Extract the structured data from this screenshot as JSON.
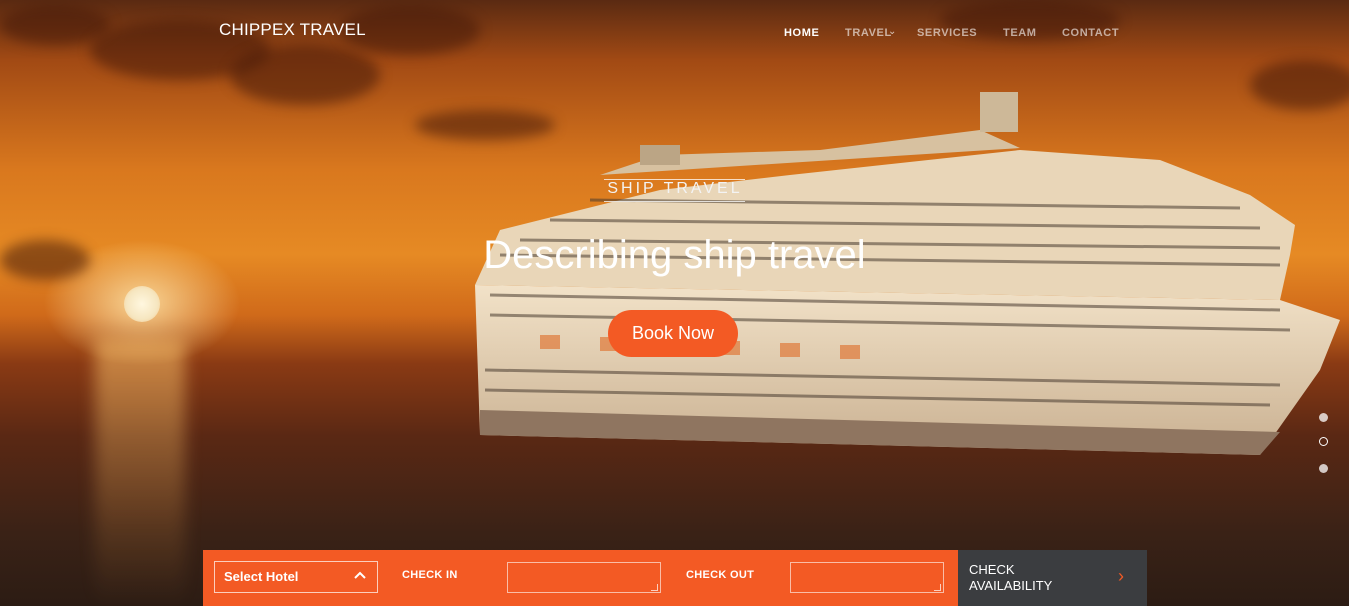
{
  "brand": {
    "name": "CHIPPEX TRAVEL"
  },
  "nav": {
    "items": [
      {
        "label": "HOME",
        "active": true
      },
      {
        "label": "TRAVEL",
        "active": false,
        "has_dropdown": true
      },
      {
        "label": "SERVICES",
        "active": false
      },
      {
        "label": "TEAM",
        "active": false
      },
      {
        "label": "CONTACT",
        "active": false
      }
    ]
  },
  "hero": {
    "kicker": "SHIP TRAVEL",
    "headline": "Describing ship travel",
    "cta_label": "Book Now"
  },
  "slider": {
    "count": 3,
    "active_index": 1
  },
  "booking": {
    "select_label": "Select Hotel",
    "check_in_label": "CHECK IN",
    "check_in_value": "",
    "check_out_label": "CHECK OUT",
    "check_out_value": "",
    "submit_label": "CHECK AVAILABILITY",
    "submit_icon": "chevron-right-icon"
  },
  "colors": {
    "accent": "#f35a24",
    "dark": "#3b3d40"
  }
}
